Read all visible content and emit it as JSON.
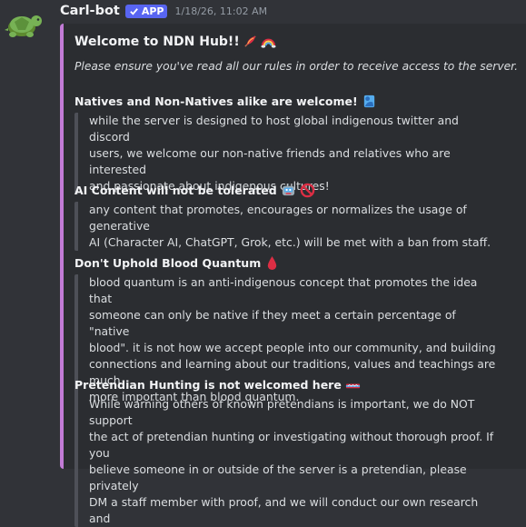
{
  "message": {
    "username": "Carl-bot",
    "app_badge": "APP",
    "timestamp": "1/18/26, 11:02 AM"
  },
  "embed": {
    "accent_color": "#c27bd6",
    "title": "Welcome to NDN Hub!!",
    "description": "Please ensure you've read all our rules in order to receive access to the server.",
    "fields": [
      {
        "name": "Natives and Non-Natives alike are welcome!",
        "lines": [
          "while the server is designed to host global indigenous twitter and discord",
          "users, we welcome our non-native friends and relatives who are interested",
          "and passionate about indigenous cultures!"
        ]
      },
      {
        "name": "AI Content will not be tolerated",
        "lines": [
          "any content that promotes, encourages or normalizes the usage of generative",
          "AI (Character AI, ChatGPT, Grok, etc.) will be met with a ban from staff."
        ]
      },
      {
        "name": "Don't Uphold Blood Quantum",
        "lines": [
          "blood quantum is an anti-indigenous concept that promotes the idea that",
          "someone can only be native if they meet a certain percentage of \"native",
          "blood\". it is not how we accept people into our community, and building",
          "connections and learning about our traditions, values and teachings are much",
          "more important than blood quantum."
        ]
      },
      {
        "name": "Pretendian Hunting is not welcomed here",
        "lines": [
          "While warning others of known pretendians is important, we do NOT support",
          "the act of pretendian hunting or investigating without thorough proof. If you",
          "believe someone in or outside of the server is a pretendian, please privately",
          "DM a staff member with proof, and we will conduct our own research and"
        ]
      }
    ]
  }
}
